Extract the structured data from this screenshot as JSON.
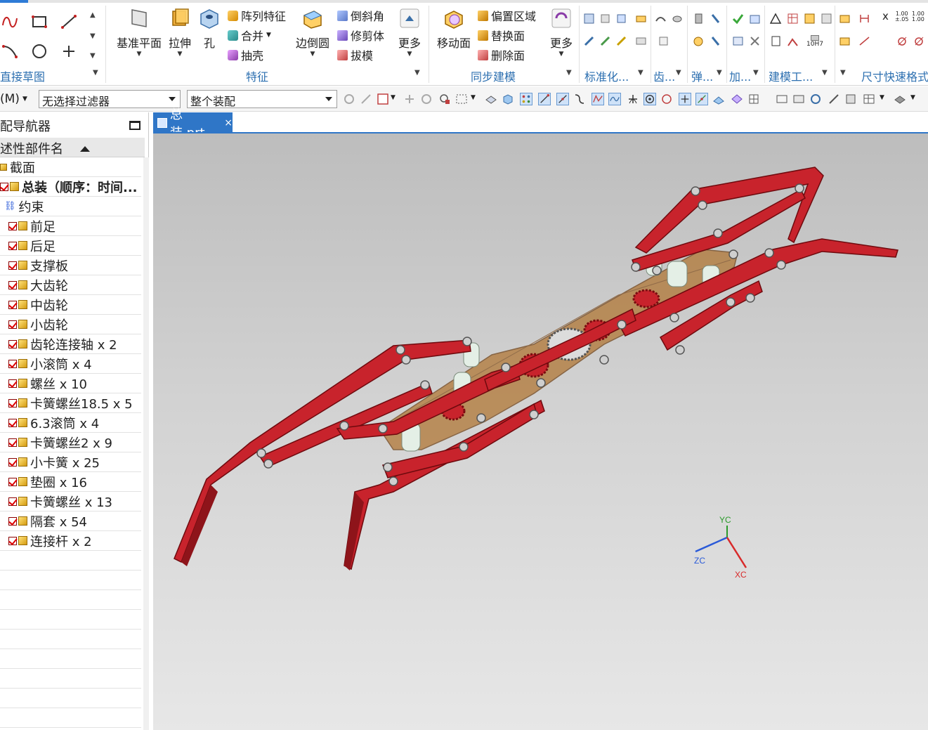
{
  "ribbon": {
    "groups": {
      "sketch_label": "直接草图",
      "feature_label": "特征",
      "sync_label": "同步建模",
      "std_label": "标准化...",
      "gear_label": "齿...",
      "spring_label": "弹...",
      "add_label": "加...",
      "tool_label": "建模工...",
      "dim_label": "尺寸快速格式"
    },
    "feature": {
      "datum_plane": "基准平面",
      "extrude": "拉伸",
      "hole": "孔",
      "pattern": "阵列特征",
      "unite": "合并",
      "shell": "抽壳",
      "edge_blend": "边倒圆",
      "chamfer": "倒斜角",
      "trim_body": "修剪体",
      "draft": "拔模",
      "more": "更多"
    },
    "sync": {
      "move_face": "移动面",
      "offset_region": "偏置区域",
      "replace_face": "替换面",
      "delete_face": "删除面",
      "more": "更多"
    },
    "dim_values": [
      "1.00",
      "1.00",
      "±.05",
      "1.00"
    ],
    "fit_label": "10H7",
    "coord_x": "x"
  },
  "toolbar": {
    "menu_label": "(M)",
    "filter_value": "无选择过滤器",
    "scope_value": "整个装配"
  },
  "navigator": {
    "title": "配导航器",
    "column_header": "述性部件名",
    "items": [
      {
        "label": "截面",
        "bold": false
      },
      {
        "label": "总装（顺序：时间...",
        "bold": true
      },
      {
        "label": "约束",
        "bold": false
      },
      {
        "label": "前足",
        "bold": false
      },
      {
        "label": "后足",
        "bold": false
      },
      {
        "label": "支撑板",
        "bold": false
      },
      {
        "label": "大齿轮",
        "bold": false
      },
      {
        "label": "中齿轮",
        "bold": false
      },
      {
        "label": "小齿轮",
        "bold": false
      },
      {
        "label": "齿轮连接轴 x 2",
        "bold": false
      },
      {
        "label": "小滚筒 x 4",
        "bold": false
      },
      {
        "label": "螺丝 x 10",
        "bold": false
      },
      {
        "label": "卡簧螺丝18.5 x 5",
        "bold": false
      },
      {
        "label": "6.3滚筒 x 4",
        "bold": false
      },
      {
        "label": "卡簧螺丝2 x 9",
        "bold": false
      },
      {
        "label": "小卡簧 x 25",
        "bold": false
      },
      {
        "label": "垫圈 x 16",
        "bold": false
      },
      {
        "label": "卡簧螺丝 x 13",
        "bold": false
      },
      {
        "label": "隔套 x 54",
        "bold": false
      },
      {
        "label": "连接杆 x 2",
        "bold": false
      }
    ]
  },
  "tab": {
    "label": "总装.prt",
    "close": "×"
  },
  "triad": {
    "yc": "YC",
    "zc": "ZC",
    "xc": "XC"
  },
  "colors": {
    "accent": "#2f76c7",
    "part_red": "#c8232c",
    "bracket": "#a0621e",
    "roller": "#e4efe6"
  }
}
